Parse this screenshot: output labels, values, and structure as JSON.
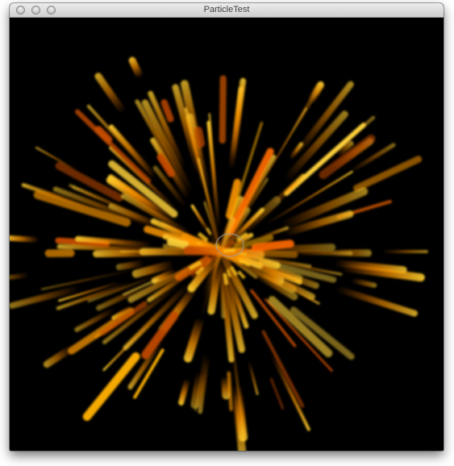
{
  "window": {
    "title": "ParticleTest"
  },
  "titlebar": {
    "buttons": [
      "close-button",
      "minimize-button",
      "zoom-button"
    ]
  },
  "scene": {
    "background_color": "#000000",
    "particle_colors": [
      "#ff9900",
      "#ffb000",
      "#ffd23a",
      "#ff6a00",
      "#c24a00"
    ]
  }
}
